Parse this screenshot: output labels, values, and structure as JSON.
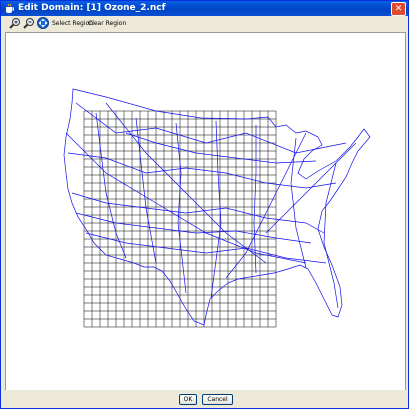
{
  "window": {
    "title": "Edit Domain: [1] Ozone_2.ncf",
    "close_glyph": "✕",
    "app_icon": "java-cup-icon"
  },
  "toolbar": {
    "zoom_in_icon": "zoom-in-icon",
    "zoom_out_icon": "zoom-out-icon",
    "pan_icon": "pan-icon",
    "select_region_label": "Select Region",
    "clear_region_label": "Clear Region"
  },
  "buttons": {
    "ok_label": "OK",
    "cancel_label": "Cancel"
  },
  "colors": {
    "titlebar": "#0a5ee8",
    "map_lines": "#0000ff",
    "grid_lines": "#000000",
    "panel": "#ece9d8"
  }
}
